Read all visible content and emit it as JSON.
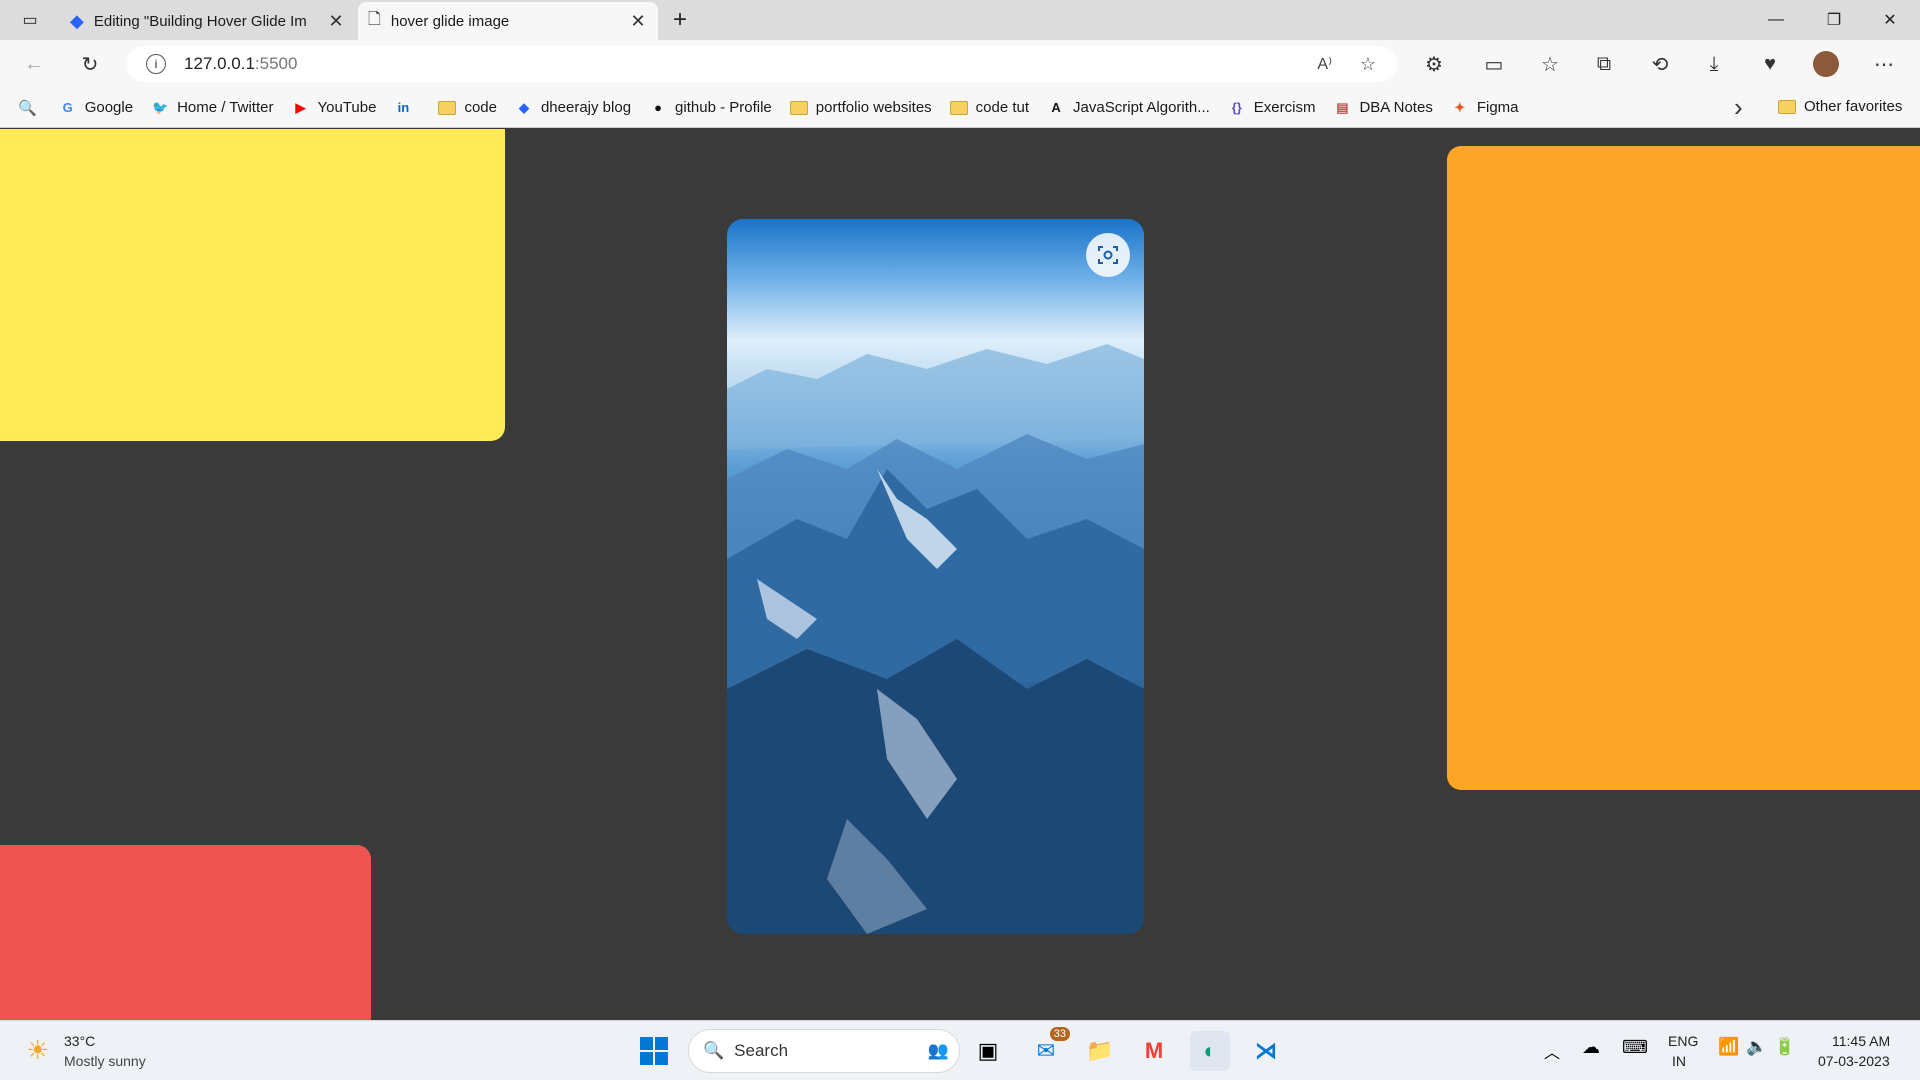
{
  "tabs": [
    {
      "title": "Editing \"Building Hover Glide Im",
      "close": "✕"
    },
    {
      "title": "hover glide image",
      "close": "✕"
    }
  ],
  "new_tab": "+",
  "window": {
    "minimize": "—",
    "restore": "❐",
    "close": "✕"
  },
  "address": {
    "url": "127.0.0.1",
    "port": ":5500"
  },
  "bookmarks": [
    {
      "label": "Google",
      "icon": "google-icon",
      "color": "#4285f4",
      "glyph": "G"
    },
    {
      "label": "Home / Twitter",
      "icon": "twitter-icon",
      "color": "#1d9bf0",
      "glyph": "🐦"
    },
    {
      "label": "YouTube",
      "icon": "youtube-icon",
      "color": "#ff0000",
      "glyph": "▶"
    },
    {
      "label": "",
      "icon": "linkedin-icon",
      "color": "#0a66c2",
      "glyph": "in"
    },
    {
      "label": "code",
      "icon": "folder-icon"
    },
    {
      "label": "dheerajy blog",
      "icon": "hashnode-icon",
      "color": "#2962ff",
      "glyph": "◆"
    },
    {
      "label": "github - Profile",
      "icon": "github-icon",
      "color": "#111",
      "glyph": "●"
    },
    {
      "label": "portfolio websites",
      "icon": "folder-icon"
    },
    {
      "label": "code tut",
      "icon": "folder-icon"
    },
    {
      "label": "JavaScript Algorith...",
      "icon": "fcc-icon",
      "color": "#111",
      "glyph": "A"
    },
    {
      "label": "Exercism",
      "icon": "exercism-icon",
      "color": "#604fcd",
      "glyph": "{}"
    },
    {
      "label": "DBA Notes",
      "icon": "notes-icon",
      "color": "#c0504d",
      "glyph": "▤"
    },
    {
      "label": "Figma",
      "icon": "figma-icon",
      "color": "#f24e1e",
      "glyph": "✦"
    }
  ],
  "bookmarks_more": "›",
  "other_favorites": "Other favorites",
  "colors": {
    "yellow": "#fdea54",
    "orange": "#fda527",
    "red": "#ef5350",
    "bg": "#3a3a3a"
  },
  "taskbar": {
    "weather_temp": "33°C",
    "weather_desc": "Mostly sunny",
    "search_label": "Search",
    "mail_badge": "33",
    "lang": "ENG",
    "region": "IN",
    "time": "11:45 AM",
    "date": "07-03-2023"
  }
}
